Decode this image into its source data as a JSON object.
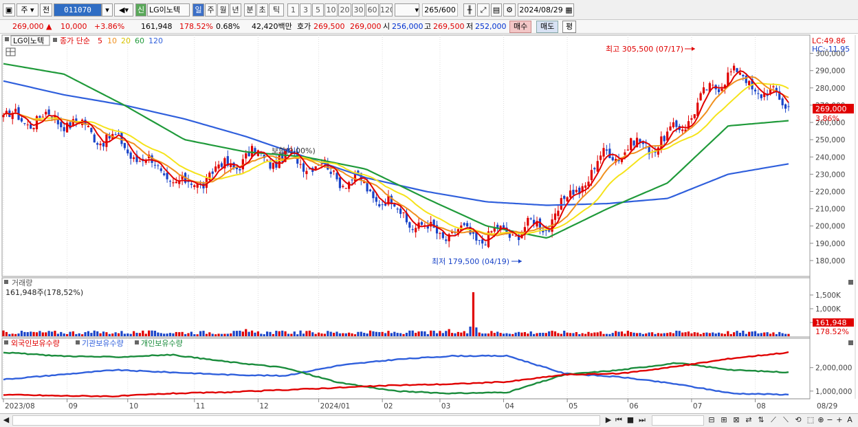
{
  "toolbar": {
    "period_type": "주",
    "prev_label": "전",
    "stock_code": "011070",
    "market_badge": "신",
    "stock_name": "LG이노텍",
    "timeframes": [
      "일",
      "주",
      "월",
      "년",
      "분",
      "초",
      "틱"
    ],
    "active_timeframe": "일",
    "intervals": [
      "1",
      "3",
      "5",
      "10",
      "20",
      "30",
      "60",
      "120"
    ],
    "count": "265",
    "count_max": "/600",
    "date": "2024/08/29"
  },
  "quote": {
    "price": "269,000",
    "change": "10,000",
    "change_pct": "+3.86%",
    "volume": "161,948",
    "volume_ratio": "178.52%",
    "turnover": "0.68%",
    "amount": "42,420백만",
    "bid_label": "호가",
    "bid": "269,500",
    "ask": "269,000",
    "open_label": "시",
    "open": "256,000",
    "high_label": "고",
    "high": "269,500",
    "low_label": "저",
    "low": "252,000",
    "buy_button": "매수",
    "sell_button": "매도",
    "eval_button": "평"
  },
  "legend": {
    "stock": "LG이노텍",
    "ma_title": "종가 단순",
    "ma_periods": [
      "5",
      "10",
      "20",
      "60",
      "120"
    ]
  },
  "price_panel": {
    "lc": "LC:49.86",
    "hc": "HC:-11.95",
    "high_annotation": "최고 305,500 (07/17)",
    "low_annotation": "최저 179,500 (04/19)",
    "mid_annotation": "보합(0.00%)",
    "current_price": "269,000",
    "current_pct": "3.86%",
    "y_ticks": [
      "300,000",
      "290,000",
      "280,000",
      "270,000",
      "260,000",
      "250,000",
      "240,000",
      "230,000",
      "220,000",
      "210,000",
      "200,000",
      "190,000",
      "180,000"
    ]
  },
  "volume_panel": {
    "title": "거래량",
    "subtitle": "161,948주(178,52%)",
    "y_ticks": [
      "1,500K",
      "1,000K",
      "500,000"
    ],
    "current": "161,948",
    "current_pct": "178.52%"
  },
  "holdings_panel": {
    "series": [
      "외국인보유수량",
      "기관보유수량",
      "개인보유수량"
    ],
    "y_ticks": [
      "2,000,000",
      "1,000,000"
    ]
  },
  "x_ticks": [
    "2023/08",
    "09",
    "10",
    "11",
    "12",
    "2024/01",
    "02",
    "03",
    "04",
    "05",
    "06",
    "07",
    "08",
    "08/29"
  ],
  "colors": {
    "ma5": "#e00000",
    "ma10": "#f0901e",
    "ma20": "#f5e31a",
    "ma60": "#1f9a3a",
    "ma120": "#2f5fdc",
    "candle_up": "#e00000",
    "candle_down": "#1a44c8",
    "foreign": "#1a8c3c",
    "institution": "#2f5fdc",
    "individual": "#e00000"
  },
  "chart_data": {
    "type": "candlestick",
    "price_range": [
      172000,
      309000
    ],
    "x": [
      "2023/08",
      "09",
      "10",
      "11",
      "12",
      "2024/01",
      "02",
      "03",
      "04",
      "05",
      "06",
      "07",
      "08",
      "08/29"
    ],
    "close_approx": [
      262000,
      262000,
      246000,
      222000,
      240000,
      238000,
      222000,
      197000,
      194000,
      201000,
      242000,
      250000,
      290000,
      269000
    ],
    "ma120_approx": [
      284000,
      276000,
      270000,
      262000,
      252000,
      240000,
      228000,
      220000,
      214000,
      212000,
      213000,
      216000,
      230000,
      236000
    ],
    "ma60_approx": [
      294000,
      288000,
      270000,
      250000,
      243000,
      240000,
      233000,
      216000,
      200000,
      193000,
      210000,
      225000,
      258000,
      261000
    ]
  }
}
